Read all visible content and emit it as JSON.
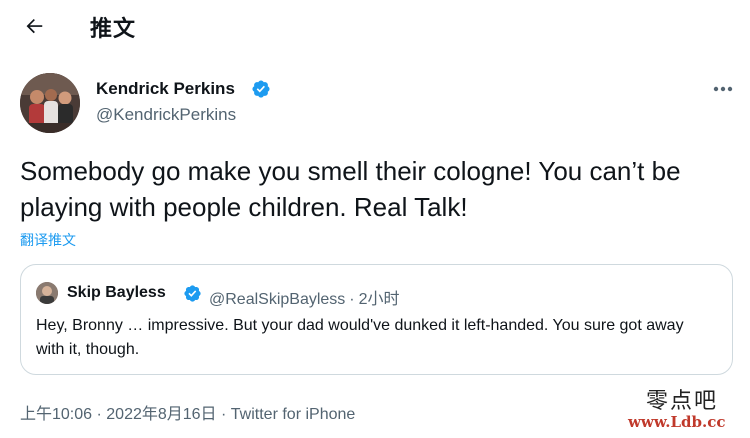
{
  "header": {
    "title": "推文",
    "back_icon": "arrow-left-icon"
  },
  "author": {
    "display_name": "Kendrick Perkins",
    "handle": "@KendrickPerkins",
    "verified": true,
    "verified_color": "#1d9bf0"
  },
  "tweet": {
    "text": "Somebody go make you smell their cologne! You can’t be playing with people children. Real Talk!",
    "translate_label": "翻译推文"
  },
  "quoted": {
    "display_name": "Skip Bayless",
    "handle": "@RealSkipBayless",
    "separator": "·",
    "time": "2小时",
    "text": "Hey, Bronny … impressive. But your dad would've dunked it left-handed. You sure got away with it, though."
  },
  "meta": {
    "time": "上午10:06",
    "separator": " · ",
    "date": "2022年8月16日",
    "source": "Twitter for iPhone"
  },
  "watermark": {
    "cn": "零点吧",
    "url": "www.Ldb.cc"
  },
  "colors": {
    "accent": "#1d9bf0",
    "text": "#0f1419",
    "secondary": "#536471",
    "border": "#cfd9de"
  }
}
